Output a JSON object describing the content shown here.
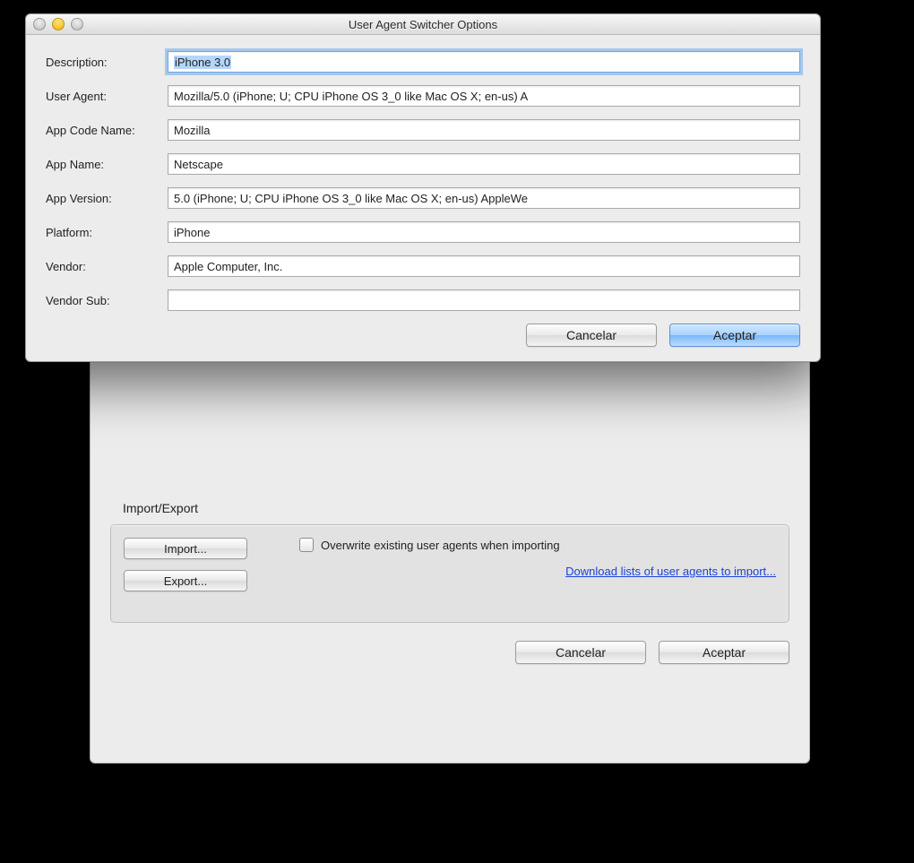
{
  "dialog": {
    "title": "User Agent Switcher Options",
    "fields": {
      "description_label": "Description:",
      "description_value": "iPhone 3.0",
      "user_agent_label": "User Agent:",
      "user_agent_value": "Mozilla/5.0 (iPhone; U; CPU iPhone OS 3_0 like Mac OS X; en-us) A",
      "app_code_name_label": "App Code Name:",
      "app_code_name_value": "Mozilla",
      "app_name_label": "App Name:",
      "app_name_value": "Netscape",
      "app_version_label": "App Version:",
      "app_version_value": "5.0 (iPhone; U; CPU iPhone OS 3_0 like Mac OS X; en-us) AppleWe",
      "platform_label": "Platform:",
      "platform_value": "iPhone",
      "vendor_label": "Vendor:",
      "vendor_value": "Apple Computer, Inc.",
      "vendor_sub_label": "Vendor Sub:",
      "vendor_sub_value": ""
    },
    "buttons": {
      "cancel": "Cancelar",
      "accept": "Aceptar"
    }
  },
  "back": {
    "section_title": "Import/Export",
    "import_btn": "Import...",
    "export_btn": "Export...",
    "overwrite_label": "Overwrite existing user agents when importing",
    "download_link": "Download lists of user agents to import...",
    "cancel": "Cancelar",
    "accept": "Aceptar"
  }
}
